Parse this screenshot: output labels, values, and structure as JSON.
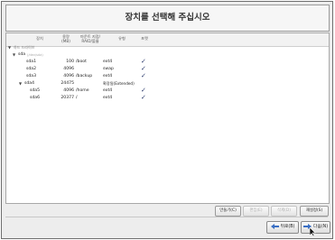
{
  "title": "장치를 선택해 주십시오",
  "columns": {
    "device": "장치",
    "size": "용량\n(MB)",
    "mount": "마운트 지점/\nRAID/볼륨",
    "type": "유형",
    "format": "포맷"
  },
  "tree": {
    "root_label": "하드 드라이브",
    "disk_label": "sda",
    "disk_sub": "(/dev/sda)"
  },
  "rows": [
    {
      "device": "sda1",
      "size": "100",
      "mount": "/boot",
      "type": "ext4",
      "format": true
    },
    {
      "device": "sda2",
      "size": "4096",
      "mount": "",
      "type": "swap",
      "format": true
    },
    {
      "device": "sda3",
      "size": "4096",
      "mount": "/backup",
      "type": "ext4",
      "format": true
    },
    {
      "device": "sda4",
      "size": "24475",
      "mount": "",
      "type": "확장됨(Extended)",
      "format": false
    },
    {
      "device": "sda5",
      "size": "4096",
      "mount": "/home",
      "type": "ext4",
      "format": true
    },
    {
      "device": "sda6",
      "size": "20377",
      "mount": "/",
      "type": "ext4",
      "format": true
    }
  ],
  "buttons": {
    "create": "만들기(C)",
    "edit": "편집(E)",
    "delete": "삭제(D)",
    "reset": "재설정(S)"
  },
  "nav": {
    "back": "뒤로(B)",
    "next": "다음(N)"
  },
  "check_glyph": "✓"
}
